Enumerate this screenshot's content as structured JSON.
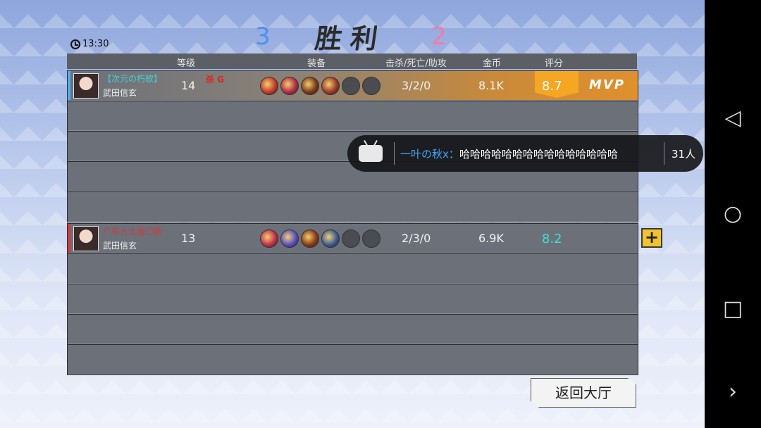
{
  "clock": {
    "time": "13:30"
  },
  "title": "胜利",
  "score": {
    "left": "3",
    "right": "2"
  },
  "columns": {
    "level": "等级",
    "equipment": "装备",
    "kda": "击杀/死亡/助攻",
    "gold": "金币",
    "rating": "评分"
  },
  "team_blue": {
    "color": "#4f8ff0",
    "players": [
      {
        "name": "【次元の朽歌】",
        "hero": "武田信玄",
        "level": "14",
        "badge": "杀 G",
        "kda": "3/2/0",
        "gold": "8.1K",
        "rating": "8.7",
        "mvp": "MVP",
        "items": [
          "#c23b2e",
          "#b32c4b",
          "#7a3a1c",
          "#9b3a2a",
          "empty",
          "empty"
        ]
      }
    ]
  },
  "team_red": {
    "color": "#d23a3a",
    "players": [
      {
        "name": "广东人大香〇蕉",
        "hero": "武田信玄",
        "level": "13",
        "kda": "2/3/0",
        "gold": "6.9K",
        "rating": "8.2",
        "items": [
          "#c03050",
          "#5a4fc8",
          "#8a3a18",
          "#3c5c9a",
          "empty",
          "empty"
        ]
      }
    ]
  },
  "add_button": "+",
  "back_button": "返回大厅",
  "danmaku": {
    "user": "一叶の秋x：",
    "message": "哈哈哈哈哈哈哈哈哈哈哈哈哈哈哈",
    "count": "31人"
  },
  "nav": {
    "back": "◁",
    "home": "○",
    "recents": "□",
    "more": "›"
  }
}
